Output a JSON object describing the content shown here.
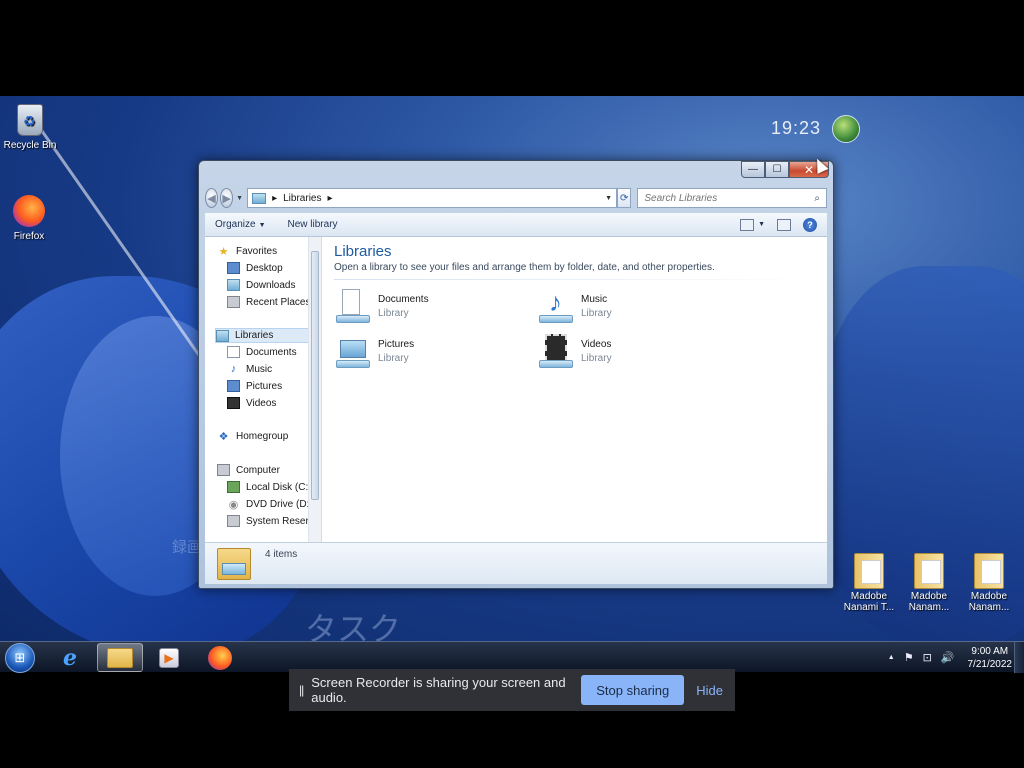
{
  "desktop": {
    "clock_widget": "19:23",
    "jp_text_1": "タスク",
    "jp_text_2": "録画",
    "icons": [
      {
        "label": "Recycle Bin",
        "icon": "recycle-bin-icon"
      },
      {
        "label": "Firefox",
        "icon": "firefox-icon"
      },
      {
        "label": "Madobe Nanami T...",
        "icon": "folder-icon"
      },
      {
        "label": "Madobe Nanam...",
        "icon": "folder-icon"
      },
      {
        "label": "Madobe Nanam...",
        "icon": "folder-icon"
      }
    ]
  },
  "window": {
    "title_buttons": {
      "minimize": "—",
      "maximize": "☐",
      "close": "✕"
    },
    "address": {
      "crumb_sep": "▸",
      "crumb": "Libraries",
      "crumb_sep2": "▸",
      "dropdown": "▼",
      "refresh": "⟳"
    },
    "search": {
      "placeholder": "Search Libraries",
      "icon": "search-icon"
    },
    "toolbar": {
      "organize": "Organize",
      "caret": "▼",
      "new_library": "New library"
    },
    "nav": {
      "favorites": "Favorites",
      "desktop": "Desktop",
      "downloads": "Downloads",
      "recent_places": "Recent Places",
      "libraries": "Libraries",
      "documents": "Documents",
      "music": "Music",
      "pictures": "Pictures",
      "videos": "Videos",
      "homegroup": "Homegroup",
      "computer": "Computer",
      "local_disk": "Local Disk (C:)",
      "dvd_drive": "DVD Drive (D:) De",
      "system_reserved": "System Reserved"
    },
    "content": {
      "title": "Libraries",
      "subtitle": "Open a library to see your files and arrange them by folder, date, and other properties.",
      "items": [
        {
          "name": "Documents",
          "kind": "Library"
        },
        {
          "name": "Music",
          "kind": "Library"
        },
        {
          "name": "Pictures",
          "kind": "Library"
        },
        {
          "name": "Videos",
          "kind": "Library"
        }
      ]
    },
    "details": {
      "count": "4 items"
    }
  },
  "taskbar": {
    "time": "9:00 AM",
    "date": "7/21/2022",
    "tray_up": "▲",
    "tray_flag": "⚑",
    "tray_network": "⊡",
    "tray_volume": "🔊"
  },
  "sharebar": {
    "pause": "||",
    "message": "Screen Recorder is sharing your screen and audio.",
    "stop": "Stop sharing",
    "hide": "Hide"
  }
}
